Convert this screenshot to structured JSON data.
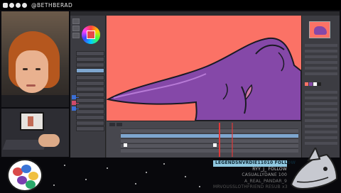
{
  "topbar": {
    "social_icons": [
      "twitter-icon",
      "twitch-icon",
      "instagram-icon",
      "youtube-icon"
    ],
    "handle": "@BETHBERAD"
  },
  "colors": {
    "canvas_bg": "#fb7266",
    "character_purple": "#8548a8",
    "line_dark": "#1a1a24",
    "selection_blue": "#7ea6cf",
    "event_highlight": "#8fc7df",
    "playhead_red": "#e03a3a"
  },
  "events": {
    "items": [
      {
        "text": "LEGENDSNVRDIE11010 FOLLOW",
        "style": "hl"
      },
      {
        "text": "RYY_J_ FOLLOW",
        "style": "dim1"
      },
      {
        "text": "CASUALLYDANE 100",
        "style": "dim2"
      },
      {
        "text": "A_REAL_PANDAR_9",
        "style": "dim3"
      },
      {
        "text": "MRVOUSSLOTHFRIEND RESUB x3",
        "style": "dim4"
      }
    ]
  },
  "webcam": {
    "subject": "streamer-face"
  },
  "deskcam": {
    "subject": "drawing-tablet-desk"
  },
  "app": {
    "canvas_subject": "purple-character-head-closeup",
    "panels": [
      "color-wheel",
      "layers",
      "navigator",
      "timeline"
    ]
  },
  "overlay": {
    "logo": "planet-logo",
    "mascot": "shark-mascot-icon"
  }
}
